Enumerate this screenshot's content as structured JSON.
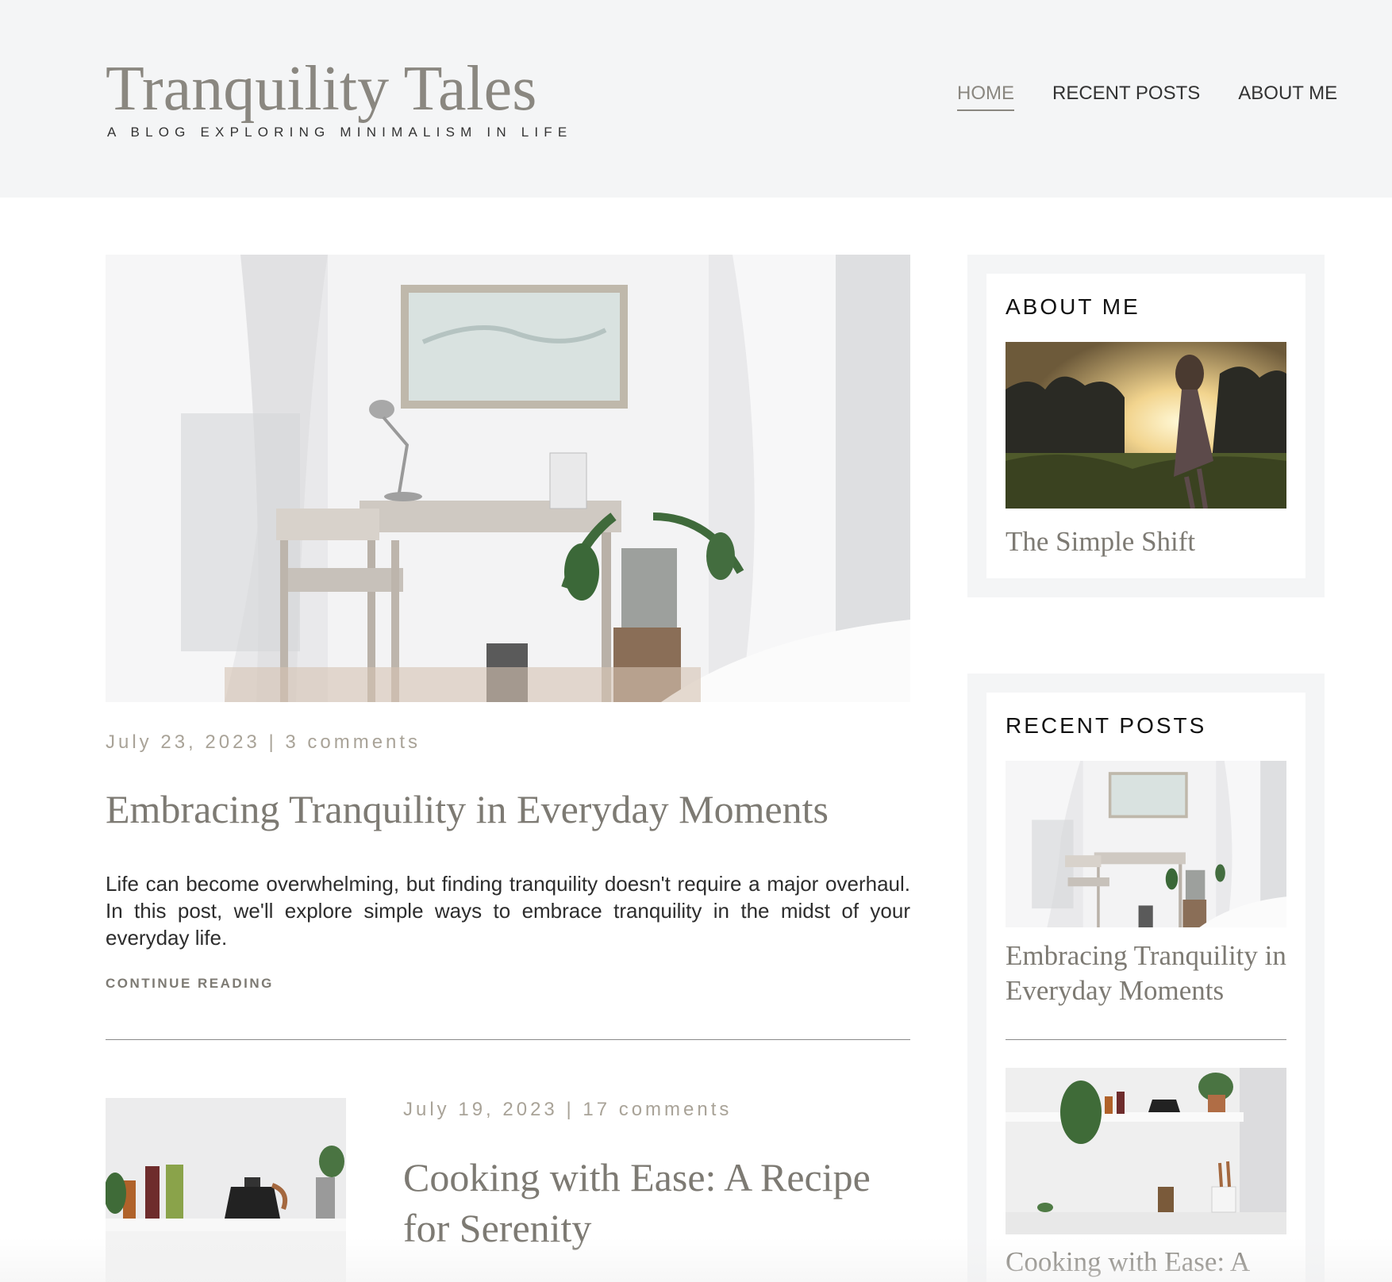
{
  "site": {
    "title": "Tranquility Tales",
    "tagline": "A BLOG EXPLORING MINIMALISM IN LIFE"
  },
  "nav": {
    "items": [
      {
        "label": "HOME",
        "active": true
      },
      {
        "label": "RECENT POSTS",
        "active": false
      },
      {
        "label": "ABOUT ME",
        "active": false
      }
    ]
  },
  "posts": [
    {
      "meta": "July 23, 2023 | 3 comments",
      "title": "Embracing Tranquility in Everyday Moments",
      "excerpt": "Life can become overwhelming, but finding tranquility doesn't require a major overhaul. In this post, we'll explore simple ways to embrace tranquility in the midst of your everyday life.",
      "continue_label": "CONTINUE READING"
    },
    {
      "meta": "July 19, 2023 | 17 comments",
      "title": "Cooking with Ease: A Recipe for Serenity"
    }
  ],
  "sidebar": {
    "about": {
      "title": "ABOUT ME",
      "link": "The Simple Shift"
    },
    "recent": {
      "title": "RECENT POSTS",
      "items": [
        {
          "label": "Embracing Tranquility in Everyday Moments"
        },
        {
          "label": "Cooking with Ease: A"
        }
      ]
    }
  },
  "colors": {
    "accent": "#8a8780",
    "header_bg": "#f4f5f6",
    "meta": "#a9a398"
  }
}
